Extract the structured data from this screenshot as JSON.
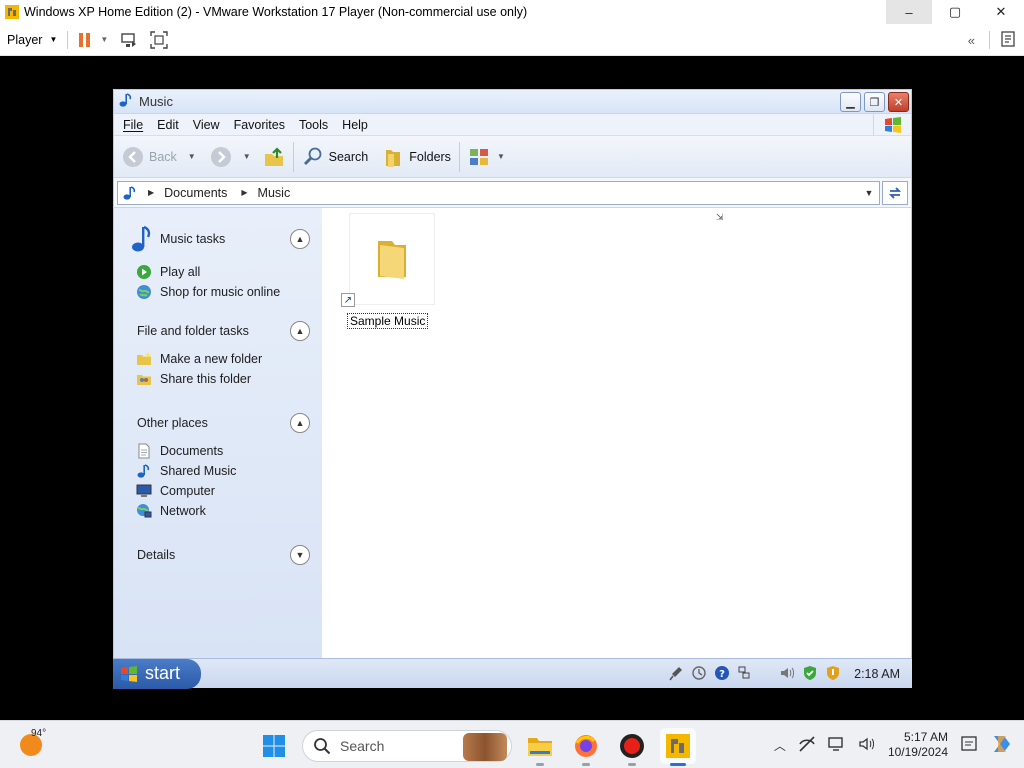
{
  "vmware": {
    "title": "Windows XP Home Edition (2) - VMware Workstation 17 Player (Non-commercial use only)",
    "player_menu": "Player",
    "window_controls": {
      "minimize": "–",
      "maximize": "▢",
      "close": "✕"
    }
  },
  "xp_window": {
    "title": "Music",
    "menu": [
      "File",
      "Edit",
      "View",
      "Favorites",
      "Tools",
      "Help"
    ],
    "toolbar": {
      "back": "Back",
      "search": "Search",
      "folders": "Folders"
    },
    "address": {
      "crumbs": [
        "Documents",
        "Music"
      ]
    },
    "task_groups": [
      {
        "title": "Music tasks",
        "tasks": [
          "Play all",
          "Shop for music online"
        ]
      },
      {
        "title": "File and folder tasks",
        "tasks": [
          "Make a new folder",
          "Share this folder"
        ]
      },
      {
        "title": "Other places",
        "tasks": [
          "Documents",
          "Shared Music",
          "Computer",
          "Network"
        ]
      },
      {
        "title": "Details",
        "tasks": []
      }
    ],
    "items": [
      {
        "name": "Sample Music",
        "type": "folder-shortcut"
      }
    ]
  },
  "xp_taskbar": {
    "start_label": "start",
    "clock": "2:18 AM"
  },
  "host_taskbar": {
    "weather_temp": "94°",
    "search_placeholder": "Search",
    "time": "5:17 AM",
    "date": "10/19/2024"
  },
  "colors": {
    "xp_blue_accent": "#2c5aa8",
    "task_pane": "#dde7f6",
    "host_accent": "#2b6de0"
  }
}
